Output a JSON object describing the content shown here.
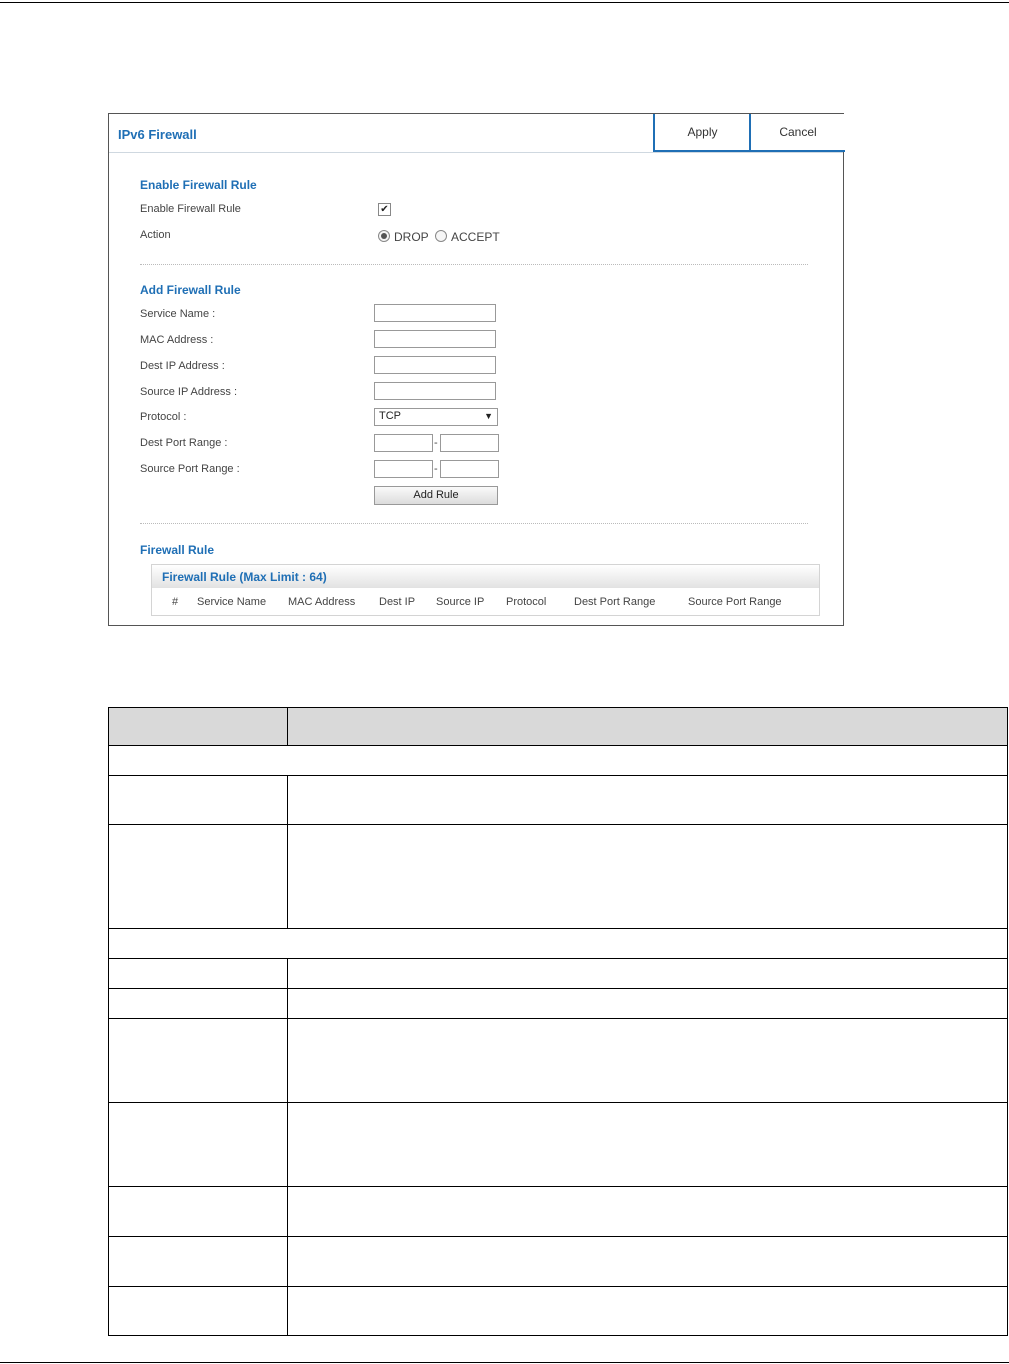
{
  "panel": {
    "title": "IPv6 Firewall",
    "apply_label": "Apply",
    "cancel_label": "Cancel"
  },
  "enable_section": {
    "title": "Enable Firewall Rule",
    "enable_label": "Enable Firewall Rule",
    "enable_checked": true,
    "action_label": "Action",
    "action_options": [
      "DROP",
      "ACCEPT"
    ],
    "action_selected": "DROP"
  },
  "add_section": {
    "title": "Add Firewall Rule",
    "service_name_label": "Service Name :",
    "mac_address_label": "MAC Address :",
    "dest_ip_label": "Dest IP Address :",
    "source_ip_label": "Source IP Address :",
    "protocol_label": "Protocol :",
    "protocol_value": "TCP",
    "dest_port_label": "Dest Port Range :",
    "source_port_label": "Source Port Range :",
    "port_separator": "-",
    "add_rule_label": "Add Rule"
  },
  "rule_section": {
    "title": "Firewall Rule",
    "table_title": "Firewall Rule (Max Limit : 64)",
    "columns": [
      "#",
      "Service Name",
      "MAC Address",
      "Dest IP",
      "Source IP",
      "Protocol",
      "Dest Port Range",
      "Source Port Range"
    ]
  },
  "icons": {
    "checkbox_mark": "✔",
    "select_arrow": "▼"
  }
}
